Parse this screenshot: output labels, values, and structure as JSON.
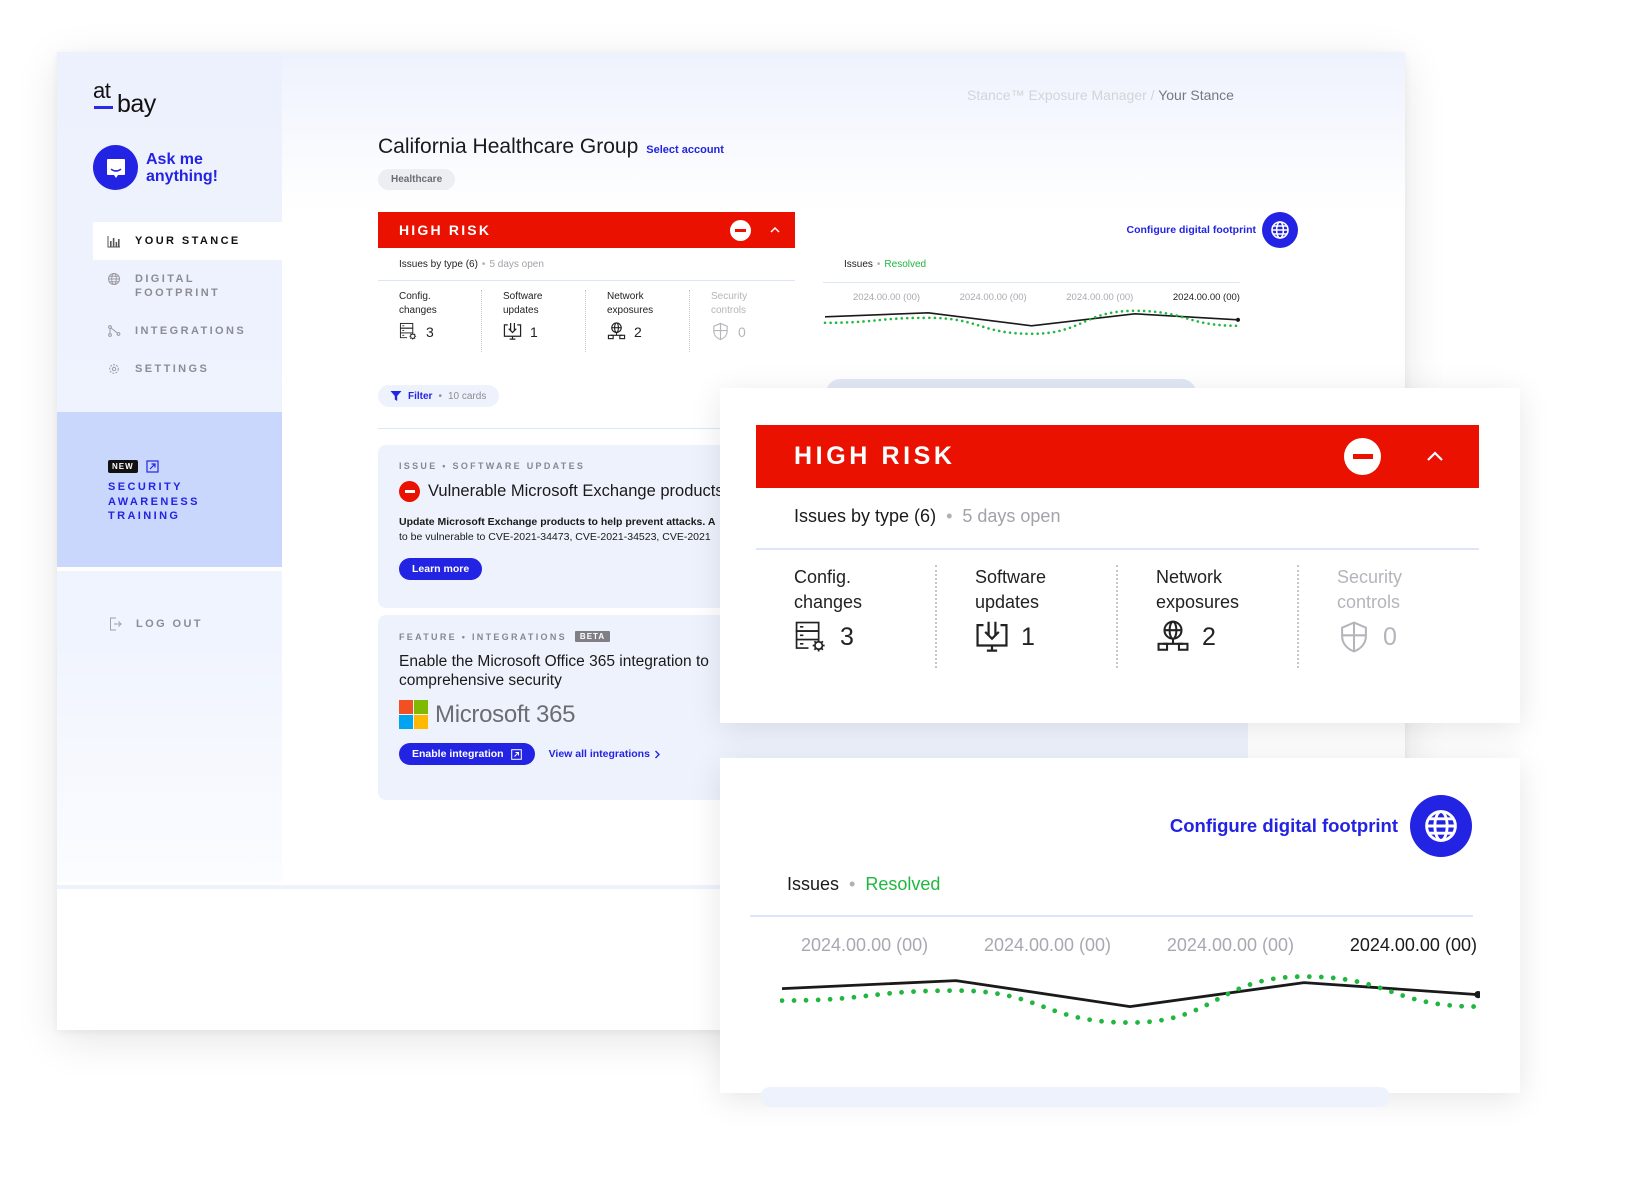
{
  "brand": {
    "logo_top": "at",
    "logo_bottom": "bay",
    "accent": "#2323e3",
    "risk_color": "#ea1100",
    "resolved_color": "#1fb73f"
  },
  "assistant": {
    "label": "Ask me anything!",
    "icon": "chat-bubble-icon"
  },
  "sidebar": {
    "items": [
      {
        "label": "YOUR STANCE",
        "icon": "bar-chart-icon",
        "active": true
      },
      {
        "label": "DIGITAL FOOTPRINT",
        "icon": "globe-icon",
        "active": false
      },
      {
        "label": "INTEGRATIONS",
        "icon": "integrations-icon",
        "active": false
      },
      {
        "label": "SETTINGS",
        "icon": "gear-icon",
        "active": false
      }
    ],
    "promo": {
      "badge": "NEW",
      "icon": "external-link-icon",
      "label": "SECURITY AWARENESS TRAINING"
    },
    "logout": {
      "label": "LOG OUT",
      "icon": "logout-icon"
    }
  },
  "breadcrumb": {
    "parent": "Stance™ Exposure Manager",
    "separator": " / ",
    "current": "Your Stance"
  },
  "account": {
    "name": "California Healthcare Group",
    "select_label": "Select account",
    "industry": "Healthcare"
  },
  "risk": {
    "level": "HIGH RISK",
    "issues_label": "Issues by type (6)",
    "days_open": "5 days open",
    "categories": [
      {
        "label_line1": "Config.",
        "label_line2": "changes",
        "count": "3",
        "icon": "server-config-icon",
        "dim": false
      },
      {
        "label_line1": "Software",
        "label_line2": "updates",
        "count": "1",
        "icon": "monitor-download-icon",
        "dim": false
      },
      {
        "label_line1": "Network",
        "label_line2": "exposures",
        "count": "2",
        "icon": "network-globe-icon",
        "dim": false
      },
      {
        "label_line1": "Security",
        "label_line2": "controls",
        "count": "0",
        "icon": "shield-icon",
        "dim": true
      }
    ]
  },
  "footprint": {
    "configure_label": "Configure digital footprint",
    "icon": "globe-icon"
  },
  "trend": {
    "issues_label": "Issues",
    "resolved_label": "Resolved",
    "dates": [
      "2024.00.00 (00)",
      "2024.00.00 (00)",
      "2024.00.00 (00)",
      "2024.00.00 (00)"
    ],
    "issues": [
      0.55,
      0.75,
      0.1,
      0.7,
      0.4
    ],
    "resolved": [
      0.25,
      0.5,
      -0.3,
      0.85,
      0.1
    ]
  },
  "filter": {
    "label": "Filter",
    "count": "10 cards"
  },
  "cards": [
    {
      "eyebrow": "ISSUE • SOFTWARE UPDATES",
      "title": "Vulnerable Microsoft Exchange products.",
      "desc_bold": "Update Microsoft Exchange products to help prevent attacks. A",
      "desc_rest": "to be vulnerable to CVE-2021-34473, CVE-2021-34523, CVE-2021",
      "button": "Learn more"
    },
    {
      "eyebrow": "FEATURE • INTEGRATIONS",
      "badge": "BETA",
      "title_line1": "Enable the Microsoft Office 365 integration to",
      "title_line2": "comprehensive security",
      "product": "Microsoft 365",
      "button": "Enable integration",
      "link": "View all integrations"
    }
  ]
}
